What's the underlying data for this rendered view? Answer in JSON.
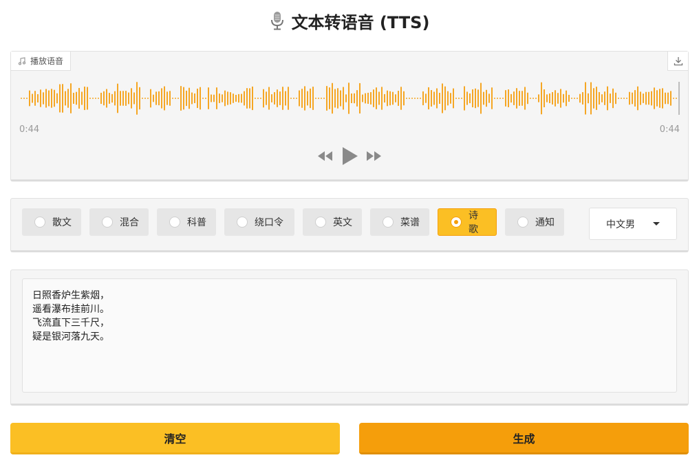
{
  "header": {
    "title": "文本转语音 (TTS)",
    "icon": "microphone-icon"
  },
  "audio": {
    "label": "播放语音",
    "label_icon": "music-note-icon",
    "download_icon": "download-icon",
    "current_time": "0:44",
    "duration": "0:44",
    "progress": 1.0,
    "wave_color": "#f5a623",
    "controls": {
      "rewind_icon": "rewind-icon",
      "play_icon": "play-icon",
      "forward_icon": "fast-forward-icon"
    }
  },
  "styles": {
    "options": [
      "散文",
      "混合",
      "科普",
      "绕口令",
      "英文",
      "菜谱",
      "诗歌",
      "通知"
    ],
    "selected": "诗歌",
    "accent": "#fbbf24"
  },
  "voice": {
    "selected": "中文男"
  },
  "text_input": {
    "value": "日照香炉生紫烟，\n遥看瀑布挂前川。\n飞流直下三千尺，\n疑是银河落九天。"
  },
  "buttons": {
    "clear_label": "清空",
    "generate_label": "生成",
    "clear_color": "#fbbf24",
    "generate_color": "#f59e0b"
  }
}
